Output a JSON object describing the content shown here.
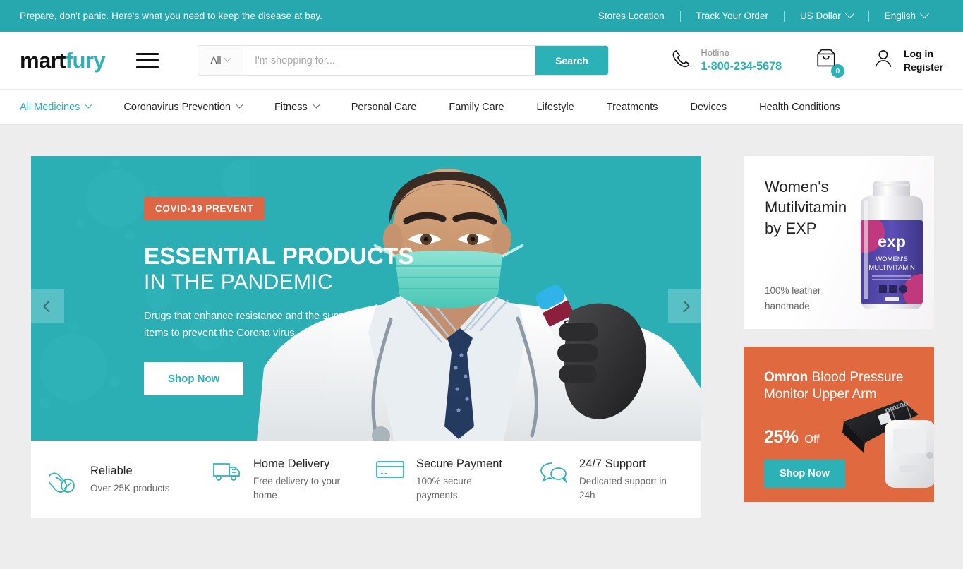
{
  "topbar": {
    "note": "Prepare, don't panic. Here's what you need to keep the disease at bay.",
    "links": [
      {
        "label": "Stores Location",
        "icon": "",
        "caret": false
      },
      {
        "label": "Track Your Order",
        "icon": "",
        "caret": false
      },
      {
        "label": "US Dollar",
        "icon": "chevron-down-icon",
        "caret": true
      },
      {
        "label": "English",
        "icon": "chevron-down-icon",
        "caret": true
      }
    ]
  },
  "header": {
    "logo_part1": "mart",
    "logo_part2": "fury",
    "menu_icon": "hamburger-menu-icon",
    "search": {
      "category_label": "All",
      "placeholder": "I'm shopping for...",
      "value": "",
      "button_label": "Search"
    },
    "hotline": {
      "icon": "phone-icon",
      "label": "Hotline",
      "number": "1-800-234-5678"
    },
    "cart": {
      "icon": "shopping-bag-icon",
      "count": "0"
    },
    "account": {
      "icon": "user-icon",
      "line1": "Log in",
      "line2": "Register"
    }
  },
  "nav": {
    "items": [
      {
        "label": "All Medicines",
        "caret": true,
        "active": true
      },
      {
        "label": "Coronavirus Prevention",
        "caret": true,
        "active": false
      },
      {
        "label": "Fitness",
        "caret": true,
        "active": false
      },
      {
        "label": "Personal Care",
        "caret": false,
        "active": false
      },
      {
        "label": "Family Care",
        "caret": false,
        "active": false
      },
      {
        "label": "Lifestyle",
        "caret": false,
        "active": false
      },
      {
        "label": "Treatments",
        "caret": false,
        "active": false
      },
      {
        "label": "Devices",
        "caret": false,
        "active": false
      },
      {
        "label": "Health Conditions",
        "caret": false,
        "active": false
      }
    ]
  },
  "hero": {
    "badge": "COVID-19 PREVENT",
    "heading_line1": "ESSENTIAL PRODUCTS",
    "heading_line2": "IN THE PANDEMIC",
    "subtitle": "Drugs that enhance resistance and the support items to prevent the Corona virus",
    "cta_label": "Shop Now",
    "prev_icon": "chevron-left-icon",
    "next_icon": "chevron-right-icon",
    "bg_color": "#2bafb5",
    "badge_color": "#dd6644"
  },
  "features": [
    {
      "icon": "pills-icon",
      "title": "Reliable",
      "desc": "Over 25K products"
    },
    {
      "icon": "delivery-truck-icon",
      "title": "Home Delivery",
      "desc": "Free delivery to your home"
    },
    {
      "icon": "credit-card-icon",
      "title": "Secure Payment",
      "desc": "100% secure payments"
    },
    {
      "icon": "chat-bubbles-icon",
      "title": "24/7 Support",
      "desc": "Dedicated support in 24h"
    }
  ],
  "promo_cards": {
    "vitamin": {
      "title_line1": "Women's",
      "title_line2": "Mutilvitamin",
      "title_line3": "by EXP",
      "sub_line1": "100% leather",
      "sub_line2": "handmade",
      "product_brand": "exp",
      "product_name1": "WOMEN'S",
      "product_name2": "MULTIVITAMIN"
    },
    "omron": {
      "brand": "Omron",
      "title_rest": " Blood Pressure Monitor Upper Arm",
      "discount": "25%",
      "discount_suffix": "Off",
      "cta_label": "Shop Now",
      "bg_color": "#e0693f"
    }
  },
  "colors": {
    "teal": "#2bb1b6",
    "teal_dark": "#26a8ae",
    "hero_teal": "#2bafb5",
    "orange": "#dd6644",
    "page_bg": "#ededed"
  }
}
